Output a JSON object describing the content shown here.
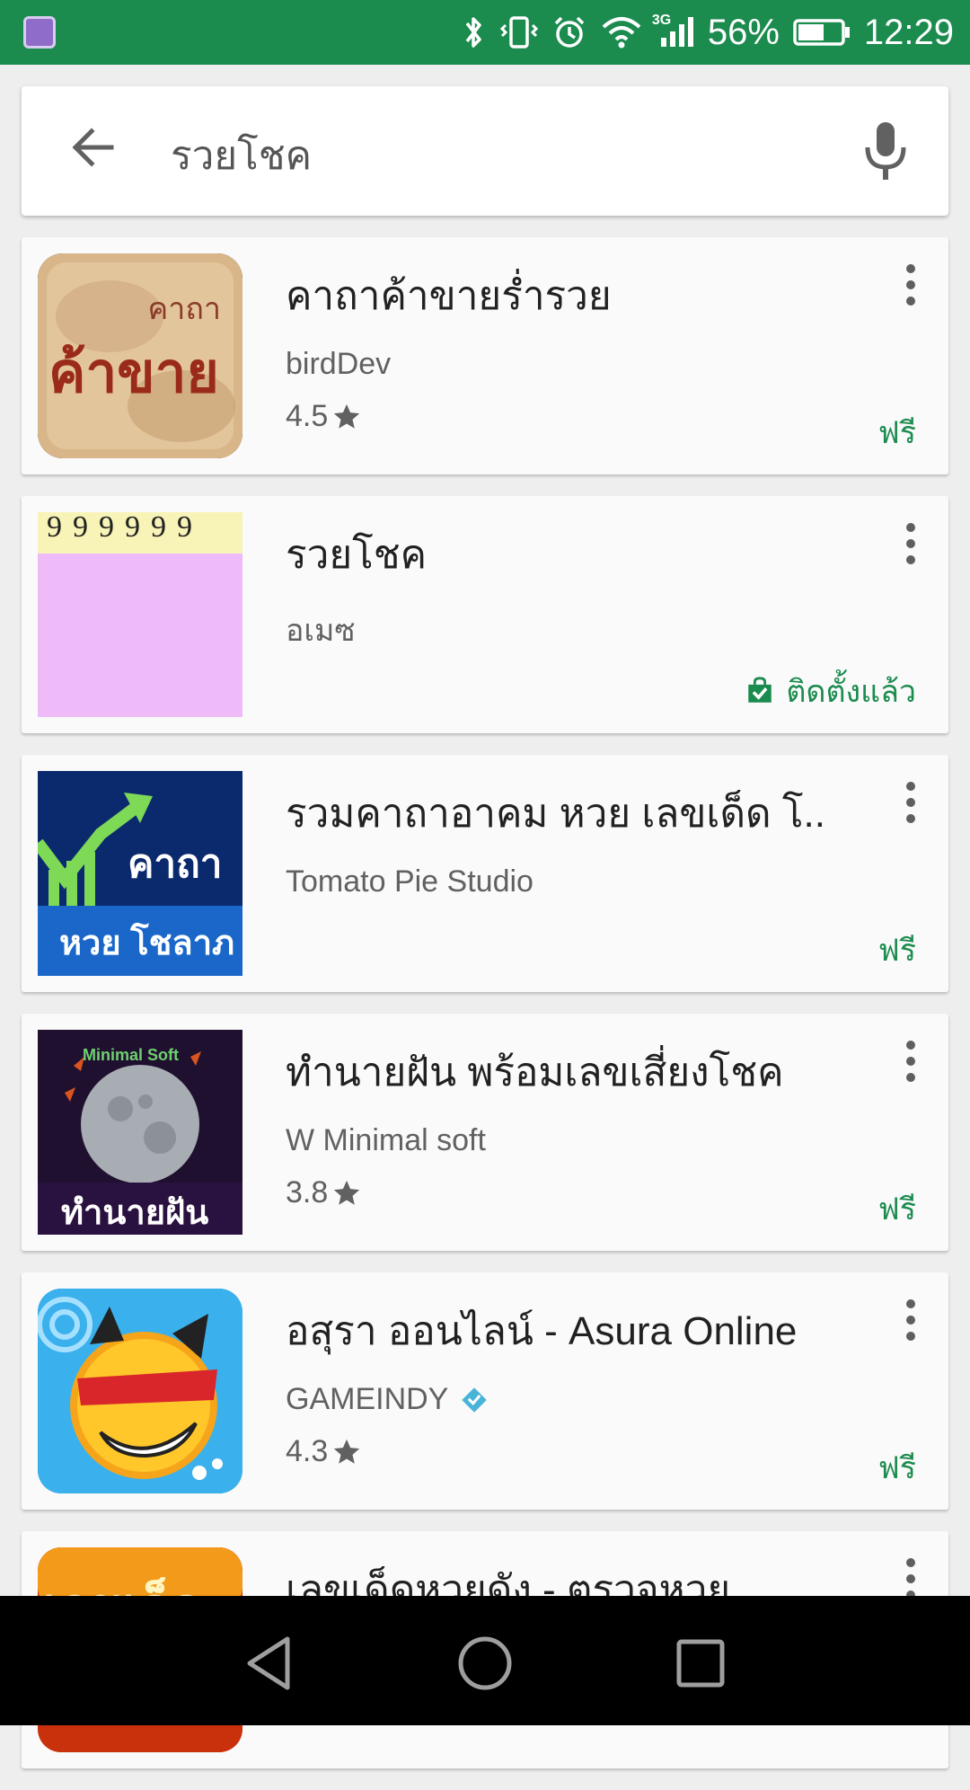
{
  "status_bar": {
    "network": "3G",
    "battery_percent": "56%",
    "time": "12:29"
  },
  "search": {
    "query": "รวยโชค"
  },
  "results": [
    {
      "title": "คาถาค้าขายร่ำรวย",
      "developer": "birdDev",
      "rating": "4.5",
      "price": "ฟรี",
      "icon_text_small": "คาถา",
      "icon_text_large": "ค้าขาย"
    },
    {
      "title": "รวยโชค",
      "developer": "อเมซ",
      "installed_label": "ติดตั้งแล้ว",
      "icon_digits": "999999"
    },
    {
      "title": "รวมคาถาอาคม หวย เลขเด็ด โ..",
      "developer": "Tomato Pie Studio",
      "price": "ฟรี",
      "icon_text_top": "คาถา",
      "icon_text_bottom": "หวย โชลาภ"
    },
    {
      "title": "ทำนายฝัน พร้อมเลขเสี่ยงโชค",
      "developer": "W Minimal soft",
      "rating": "3.8",
      "price": "ฟรี",
      "icon_text_top": "Minimal Soft",
      "icon_text_bottom": "ทำนายฝัน"
    },
    {
      "title": "อสุรา ออนไลน์ - Asura Online",
      "developer": "GAMEINDY",
      "rating": "4.3",
      "price": "ฟรี"
    },
    {
      "title": "เลขเด็ดหวยดัง - ตรวจหวย",
      "icon_text": "เลขเด็ด"
    }
  ],
  "colors": {
    "brand_green": "#1b8b4e",
    "card_bg": "#fafafa",
    "page_bg": "#eeeeee"
  }
}
